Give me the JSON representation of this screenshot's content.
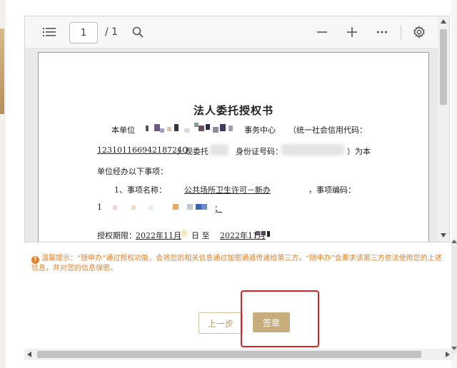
{
  "toolbar": {
    "current_page": "1",
    "total_pages": "/ 1",
    "icons": [
      "list-icon",
      "search-icon",
      "zoom-out-icon",
      "zoom-in-icon",
      "more-icon",
      "settings-icon"
    ]
  },
  "document": {
    "title": "法人委托授权书",
    "line1_prefix": "本单位",
    "line1_mid": "事务中心",
    "line1_suffix": "（统一社会信用代码：",
    "line2_code": "12310116694218724Q",
    "line2_mid": "）现委托",
    "line2_id_label": "身份证号码：",
    "line2_suffix": "）为本",
    "line3": "单位经办以下事项：",
    "line4_prefix": "1、事项名称：",
    "line4_item": "公共场所卫生许可－新办",
    "line4_suffix": "，事项编码：",
    "line5_prefix": "1",
    "line5_suffix": "；",
    "line6_prefix": "授权期限：",
    "line6_start": "2022年11月",
    "line6_mid": "日 至",
    "line6_end": "2022年11月"
  },
  "notice": {
    "text": "温馨提示：“随申办”通过授权功能，会将您的相关信息通过加密通道传递给第三方。“随申办”会要求该第三方依法使用您的上述信息，并对您的信息保密。",
    "icon": "info-icon"
  },
  "buttons": {
    "prev": "上一步",
    "sign": "签章"
  },
  "colors": {
    "accent": "#c7ad7d",
    "notice": "#e5822f",
    "highlight": "#e02020"
  }
}
